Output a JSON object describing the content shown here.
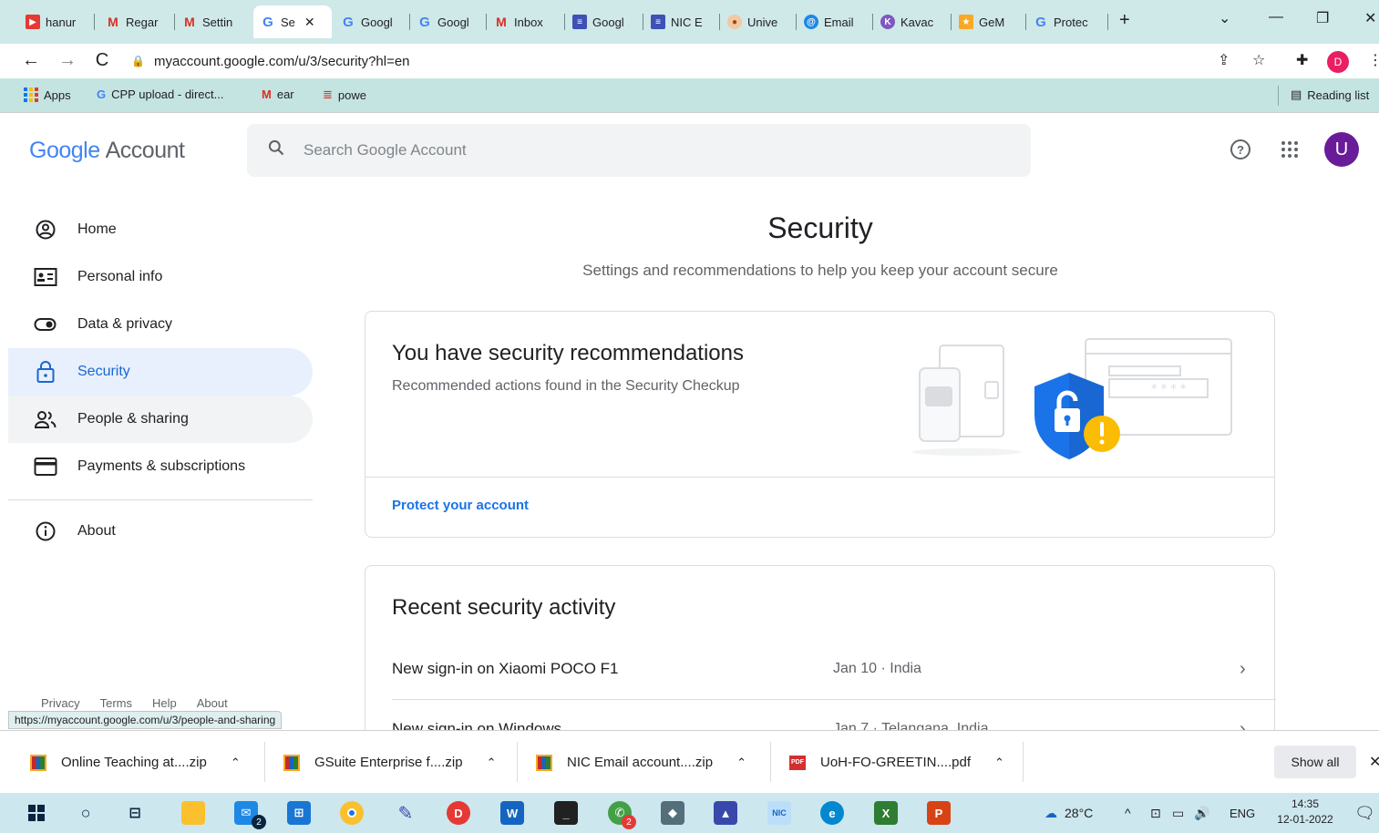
{
  "browser": {
    "tabs": [
      {
        "label": "hanur",
        "icon": "youtube-icon"
      },
      {
        "label": "Regar",
        "icon": "gmail-icon"
      },
      {
        "label": "Settin",
        "icon": "gmail-icon"
      },
      {
        "label": "Se",
        "icon": "google-icon",
        "active": true
      },
      {
        "label": "Googl",
        "icon": "google-icon"
      },
      {
        "label": "Googl",
        "icon": "google-icon"
      },
      {
        "label": "Inbox",
        "icon": "gmail-icon"
      },
      {
        "label": "Googl",
        "icon": "sheets-icon"
      },
      {
        "label": "NIC E",
        "icon": "sheets-icon"
      },
      {
        "label": "Unive",
        "icon": "university-icon"
      },
      {
        "label": "Email",
        "icon": "email-icon"
      },
      {
        "label": "Kavac",
        "icon": "kavach-icon"
      },
      {
        "label": "GeM",
        "icon": "gem-icon"
      },
      {
        "label": "Protec",
        "icon": "google-icon"
      }
    ],
    "url": "myaccount.google.com/u/3/security?hl=en",
    "profile_initial": "D",
    "bookmarks": [
      {
        "label": "Apps"
      },
      {
        "label": "CPP upload - direct..."
      },
      {
        "label": "ear"
      },
      {
        "label": "powe"
      }
    ],
    "reading_list": "Reading list",
    "status_url": "https://myaccount.google.com/u/3/people-and-sharing"
  },
  "header": {
    "logo_google": "Google",
    "logo_account": "Account",
    "search_placeholder": "Search Google Account",
    "avatar_initial": "U"
  },
  "sidebar": {
    "items": [
      {
        "label": "Home",
        "icon": "home-icon"
      },
      {
        "label": "Personal info",
        "icon": "id-card-icon"
      },
      {
        "label": "Data & privacy",
        "icon": "toggle-icon"
      },
      {
        "label": "Security",
        "icon": "lock-icon",
        "active": true
      },
      {
        "label": "People & sharing",
        "icon": "people-icon"
      },
      {
        "label": "Payments & subscriptions",
        "icon": "card-icon"
      }
    ],
    "about": "About",
    "footer": [
      "Privacy",
      "Terms",
      "Help",
      "About"
    ]
  },
  "main": {
    "title": "Security",
    "subtitle": "Settings and recommendations to help you keep your account secure",
    "recommendations": {
      "title": "You have security recommendations",
      "subtitle": "Recommended actions found in the Security Checkup",
      "link": "Protect your account"
    },
    "activity": {
      "title": "Recent security activity",
      "rows": [
        {
          "event": "New sign-in on Xiaomi POCO F1",
          "detail": "Jan 10 · India"
        },
        {
          "event": "New sign-in on Windows",
          "detail": "Jan 7 · Telangana, India"
        }
      ]
    }
  },
  "downloads": {
    "items": [
      {
        "name": "Online Teaching at....zip",
        "type": "zip"
      },
      {
        "name": "GSuite Enterprise f....zip",
        "type": "zip"
      },
      {
        "name": "NIC Email account....zip",
        "type": "zip"
      },
      {
        "name": "UoH-FO-GREETIN....pdf",
        "type": "pdf"
      }
    ],
    "show_all": "Show all"
  },
  "taskbar": {
    "mail_badge": "2",
    "whatsapp_badge": "2",
    "weather": "28°C",
    "language": "ENG",
    "time": "14:35",
    "date": "12-01-2022"
  },
  "colors": {
    "accent": "#1a73e8",
    "active_bg": "#e8f0fe",
    "shield_blue": "#1a73e8",
    "warning_yellow": "#fbbc04"
  }
}
